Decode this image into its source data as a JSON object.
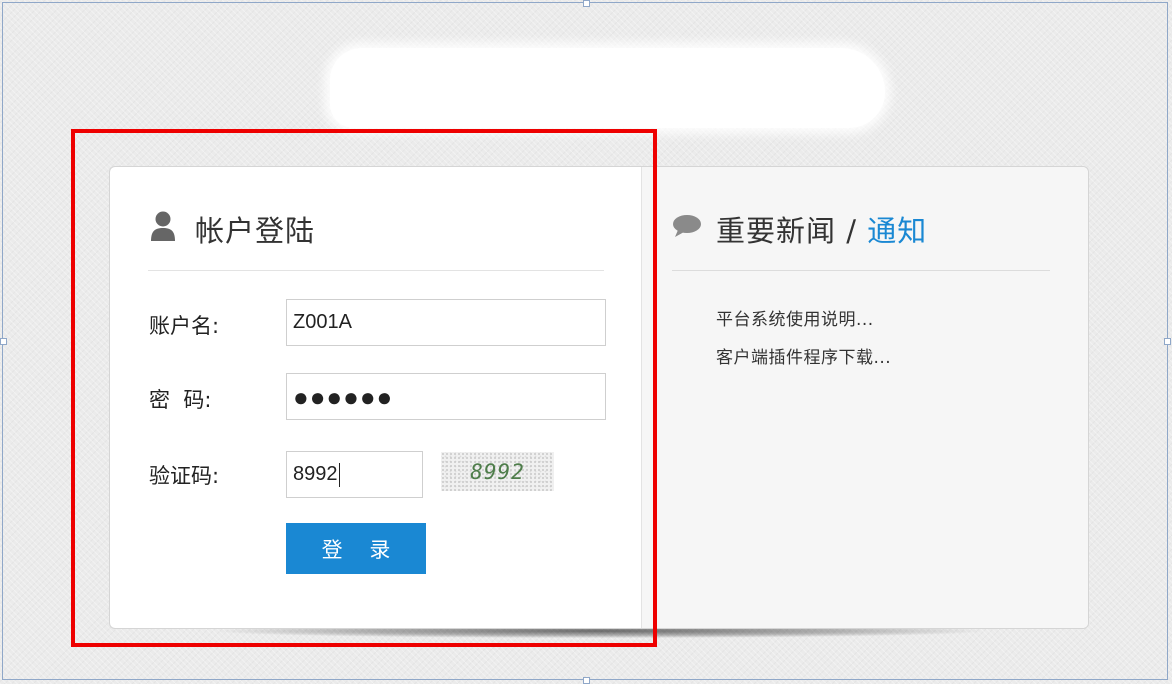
{
  "login_panel": {
    "title": "帐户登陆",
    "icon": "user-icon",
    "username_label": "账户名:",
    "username_value": "Z001A",
    "password_label": "密  码:",
    "password_masked": "●●●●●●",
    "captcha_label": "验证码:",
    "captcha_value": "8992",
    "captcha_image_text": "8992",
    "login_button": "登 录"
  },
  "news_panel": {
    "icon": "speech-bubble-icon",
    "title_main": "重要新闻",
    "title_separator": " / ",
    "title_accent": "通知",
    "items": [
      {
        "text": "平台系统使用说明..."
      },
      {
        "text": "客户端插件程序下载..."
      }
    ]
  },
  "colors": {
    "accent": "#1a88d3",
    "highlight_border": "#ee0000",
    "captcha_text": "#4e7d4a"
  }
}
